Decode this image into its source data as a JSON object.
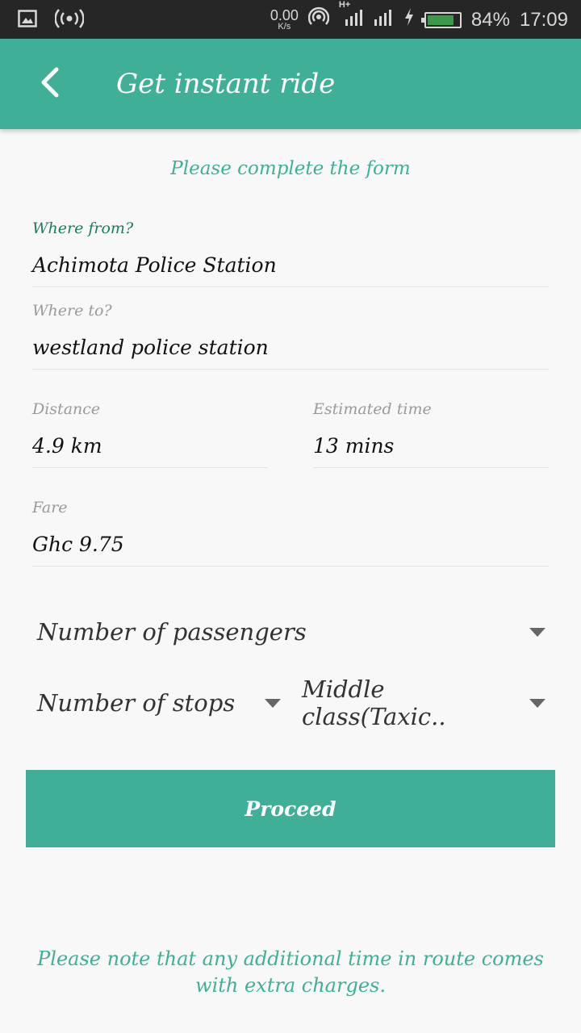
{
  "status_bar": {
    "net_speed": "0.00",
    "net_unit": "K/s",
    "network_type": "H+",
    "battery_percent": "84%",
    "battery_level": 0.84,
    "time": "17:09"
  },
  "app_bar": {
    "title": "Get instant ride",
    "back_icon": "chevron-left-icon"
  },
  "form": {
    "subtitle": "Please complete the form",
    "where_from": {
      "label": "Where from?",
      "value": "Achimota Police Station"
    },
    "where_to": {
      "label": "Where to?",
      "value": "westland police station"
    },
    "distance": {
      "label": "Distance",
      "value": "4.9 km"
    },
    "estimated_time": {
      "label": "Estimated time",
      "value": "13 mins"
    },
    "fare": {
      "label": "Fare",
      "value": "Ghc 9.75"
    },
    "passengers": {
      "label": "Number of passengers"
    },
    "stops": {
      "label": "Number of stops"
    },
    "ride_class": {
      "label": "Middle class(Taxic.."
    },
    "proceed_label": "Proceed",
    "note": "Please note that any additional time in route comes with extra charges."
  },
  "colors": {
    "accent": "#3fb097",
    "status_bar_bg": "#262626",
    "label_active": "#1f7a62"
  }
}
